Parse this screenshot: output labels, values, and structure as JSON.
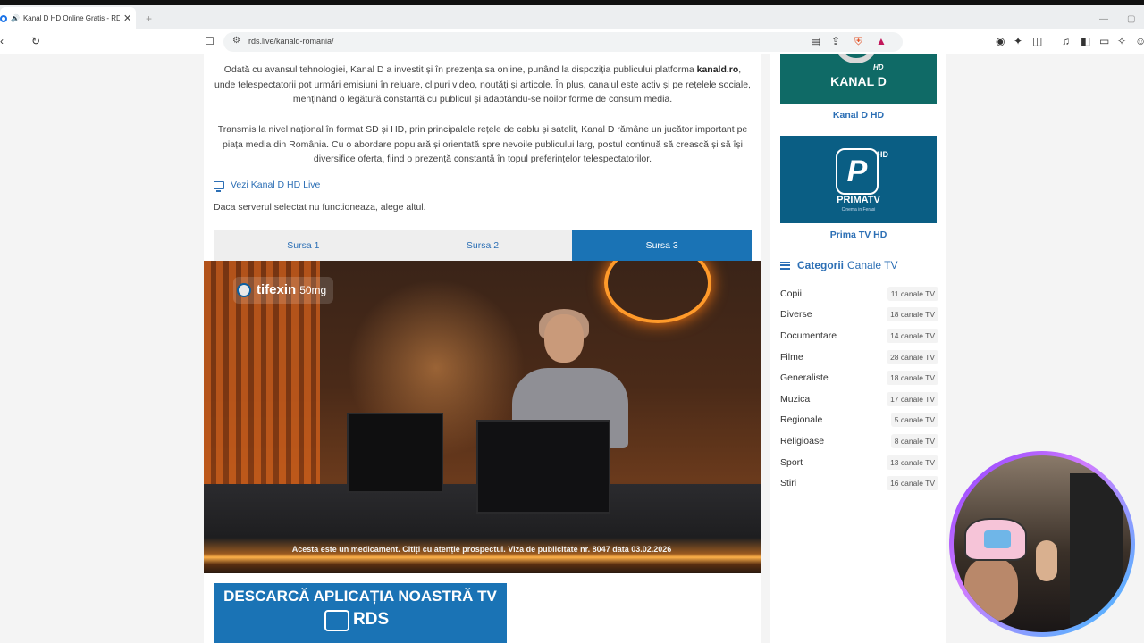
{
  "browser": {
    "tab_title": "Kanal D HD Online Gratis - RDS",
    "new_tab": "+",
    "url": "rds.live/kanald-romania/"
  },
  "article": {
    "para1_a": "Odată cu avansul tehnologiei, Kanal D a investit și în prezența sa online, punând la dispoziția publicului platforma ",
    "para1_b": "kanald.ro",
    "para1_c": ", unde telespectatorii pot urmări emisiuni în reluare, clipuri video, noutăți și articole. În plus, canalul este activ și pe rețelele sociale, menținând o legătură constantă cu publicul și adaptându-se noilor forme de consum media.",
    "para2": "Transmis la nivel național în format SD și HD, prin principalele rețele de cablu și satelit, Kanal D rămâne un jucător important pe piața media din România. Cu o abordare populară și orientată spre nevoile publicului larg, postul continuă să crească și să își diversifice oferta, fiind o prezență constantă în topul preferințelor telespectatorilor.",
    "live_link": "Vezi Kanal D HD Live",
    "server_hint": "Daca serverul selectat nu functioneaza, alege altul."
  },
  "sources": [
    "Sursa 1",
    "Sursa 2",
    "Sursa 3"
  ],
  "active_source": "Sursa 3",
  "video": {
    "ad_brand": "tifexin",
    "ad_dose": "50mg",
    "disclaimer": "Acesta este un medicament. Citiți cu atenție prospectul. Viza de publicitate nr. 8047 data 03.02.2026"
  },
  "promo": {
    "title": "DESCARCĂ APLICAȚIA NOASTRĂ TV",
    "brand": "RDS"
  },
  "sidebar": {
    "channels": [
      {
        "label": "Kanal D HD",
        "logo_text": "KANAL D",
        "logo_badge": "HD"
      },
      {
        "label": "Prima TV HD",
        "logo_text": "PRIMATV",
        "logo_badge": "HD",
        "logo_tag": "Cinema in Ferasi"
      }
    ],
    "categories_title_bold": "Categorii",
    "categories_title_rest": "Canale TV",
    "categories": [
      {
        "name": "Copii",
        "count": "11 canale TV"
      },
      {
        "name": "Diverse",
        "count": "18 canale TV"
      },
      {
        "name": "Documentare",
        "count": "14 canale TV"
      },
      {
        "name": "Filme",
        "count": "28 canale TV"
      },
      {
        "name": "Generaliste",
        "count": "18 canale TV"
      },
      {
        "name": "Muzica",
        "count": "17 canale TV"
      },
      {
        "name": "Regionale",
        "count": "5 canale TV"
      },
      {
        "name": "Religioase",
        "count": "8 canale TV"
      },
      {
        "name": "Sport",
        "count": "13 canale TV"
      },
      {
        "name": "Stiri",
        "count": "16 canale TV"
      }
    ]
  },
  "colors": {
    "accent": "#1a73b5",
    "link": "#2c6fb5"
  }
}
